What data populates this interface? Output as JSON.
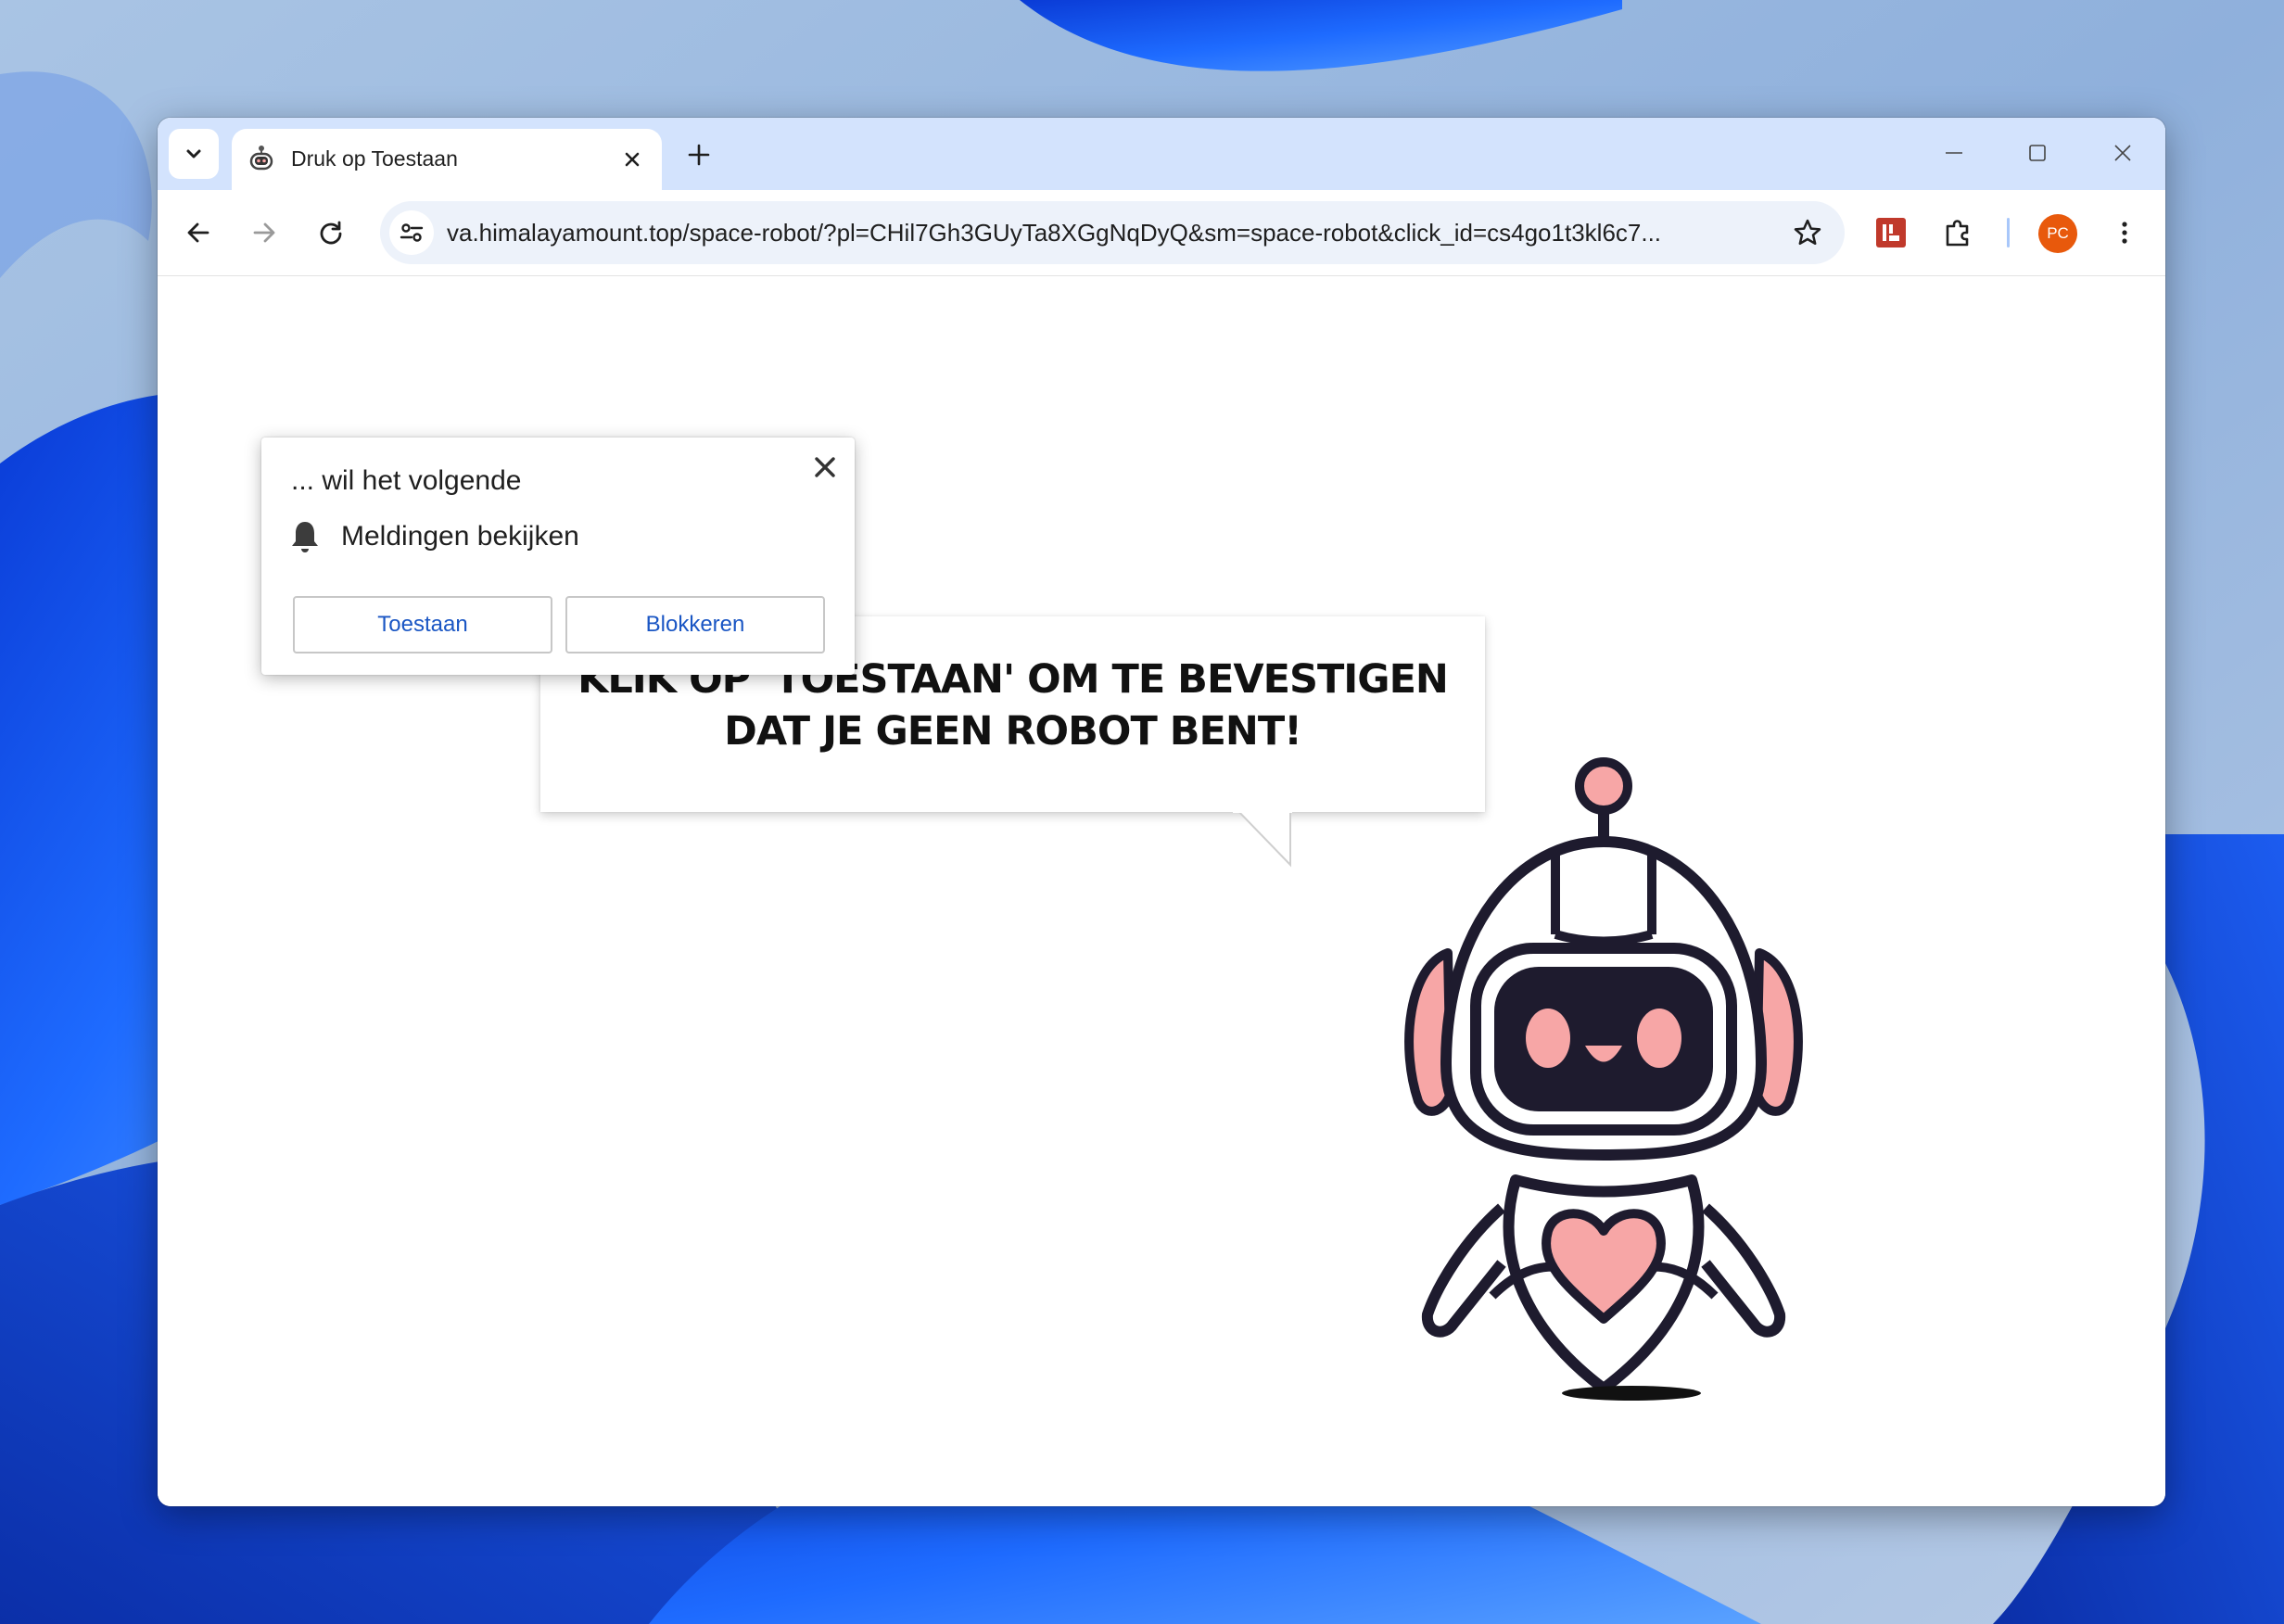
{
  "browser": {
    "tab": {
      "title": "Druk op Toestaan"
    },
    "omnibox": {
      "url": "va.himalayamount.top/space-robot/?pl=CHil7Gh3GUyTa8XGgNqDyQ&sm=space-robot&click_id=cs4go1t3kl6c7..."
    },
    "profile": {
      "initials": "PC",
      "color": "#e8590c"
    }
  },
  "permission_prompt": {
    "title": "... wil het volgende",
    "permission": "Meldingen bekijken",
    "allow_label": "Toestaan",
    "block_label": "Blokkeren"
  },
  "page": {
    "headline_line1": "KLIK OP 'TOESTAAN' OM TE BEVESTIGEN",
    "headline_line2": "DAT JE GEEN ROBOT BENT!"
  },
  "colors": {
    "tabstrip": "#d3e3fd",
    "omnibox": "#edf2fa",
    "robot_pink": "#f7a6a6",
    "robot_dark": "#1e1b2e"
  }
}
